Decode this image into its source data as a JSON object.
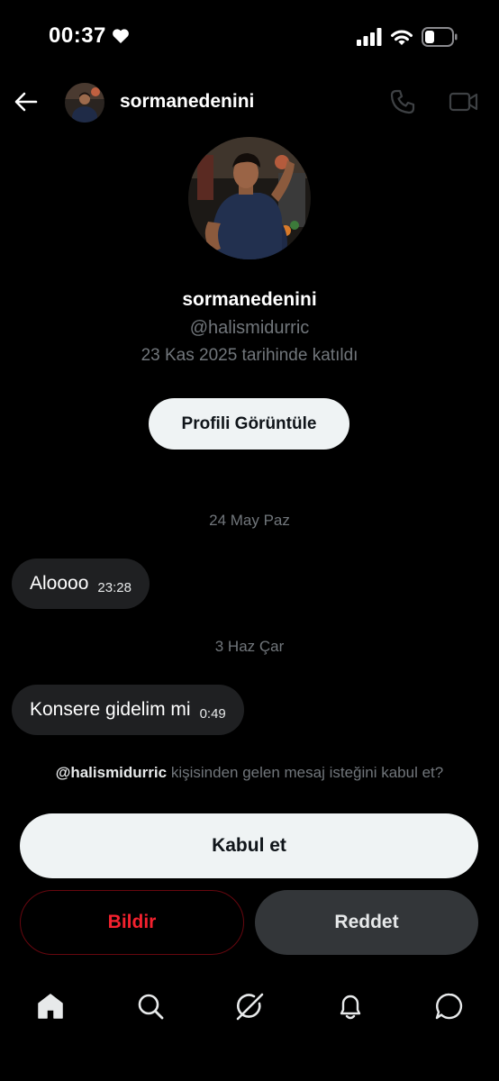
{
  "status_bar": {
    "time": "00:37",
    "icons": [
      "heart-icon",
      "signal-icon",
      "wifi-icon",
      "battery-icon"
    ]
  },
  "header": {
    "username": "sormanedenini",
    "icons": [
      "back-arrow-icon",
      "phone-icon",
      "video-camera-icon"
    ]
  },
  "profile": {
    "name": "sormanedenini",
    "handle": "@halismidurric",
    "joined": "23 Kas 2025 tarihinde katıldı",
    "view_profile_label": "Profili Görüntüle"
  },
  "messages": [
    {
      "date": "24 May Paz",
      "text": "Aloooo",
      "time": "23:28"
    },
    {
      "date": "3 Haz Çar",
      "text": "Konsere gidelim mi",
      "time": "0:49"
    }
  ],
  "request": {
    "handle": "@halismidurric",
    "text": "kişisinden gelen mesaj isteğini kabul et?",
    "accept_label": "Kabul et",
    "report_label": "Bildir",
    "reject_label": "Reddet"
  },
  "bottom_nav": {
    "items": [
      "home-icon",
      "search-icon",
      "grok-icon",
      "notifications-icon",
      "messages-icon"
    ]
  },
  "colors": {
    "background": "#000000",
    "muted_text": "#71767b",
    "bubble": "#1f2022",
    "primary_button": "#eff3f4",
    "danger": "#f4212e",
    "secondary_button": "#333639"
  }
}
